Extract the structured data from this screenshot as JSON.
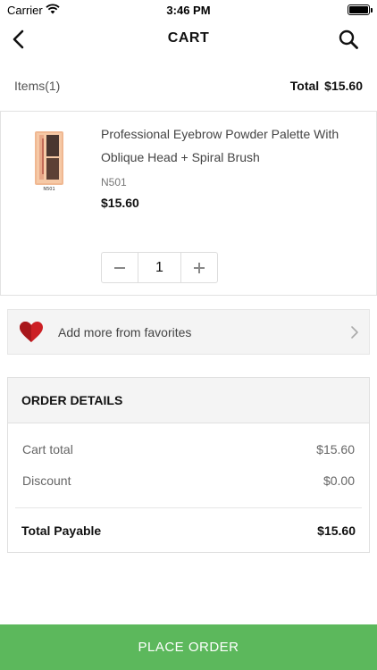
{
  "status_bar": {
    "carrier": "Carrier",
    "time": "3:46 PM"
  },
  "nav": {
    "title": "CART",
    "back_icon": "chevron-left-icon",
    "search_icon": "search-icon"
  },
  "summary": {
    "items_label": "Items(1)",
    "total_label": "Total",
    "total_value": "$15.60"
  },
  "cart_items": [
    {
      "name": "Professional Eyebrow Powder Palette With Oblique Head + Spiral Brush",
      "sku": "N501",
      "price": "$15.60",
      "quantity": "1",
      "image_label": "N501"
    }
  ],
  "stepper": {
    "minus": "−",
    "plus": "+"
  },
  "favorites": {
    "label": "Add more from favorites",
    "icon": "heart-icon"
  },
  "order_details": {
    "title": "ORDER DETAILS",
    "rows": [
      {
        "label": "Cart total",
        "value": "$15.60"
      },
      {
        "label": "Discount",
        "value": "$0.00"
      }
    ],
    "total_label": "Total Payable",
    "total_value": "$15.60"
  },
  "footer": {
    "place_order": "PLACE ORDER"
  },
  "colors": {
    "accent": "#5cb85c",
    "heart": "#cc1f24"
  }
}
